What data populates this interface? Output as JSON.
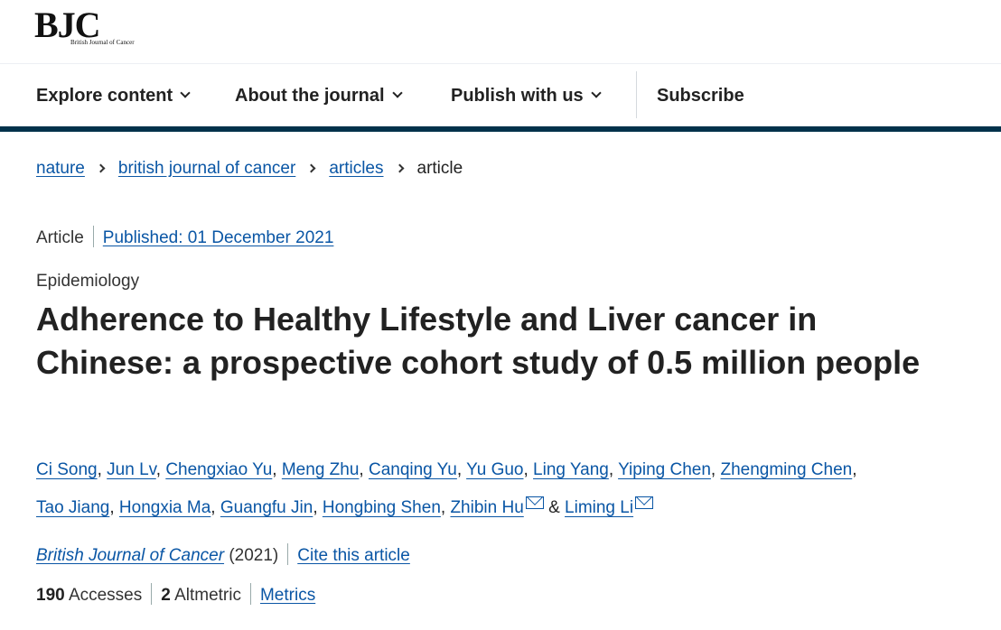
{
  "logo": {
    "text": "BJC",
    "subtitle": "British Journal of Cancer"
  },
  "nav": {
    "explore": "Explore content",
    "about": "About the journal",
    "publish": "Publish with us",
    "subscribe": "Subscribe"
  },
  "breadcrumb": [
    "nature",
    "british journal of cancer",
    "articles",
    "article"
  ],
  "article": {
    "type": "Article",
    "published": "Published: 01 December 2021",
    "subject": "Epidemiology",
    "title": "Adherence to Healthy Lifestyle and Liver cancer in Chinese: a prospective cohort study of 0.5 million people",
    "authors": [
      "Ci Song",
      "Jun Lv",
      "Chengxiao Yu",
      "Meng Zhu",
      "Canqing Yu",
      "Yu Guo",
      "Ling Yang",
      "Yiping Chen",
      "Zhengming Chen",
      "Tao Jiang",
      "Hongxia Ma",
      "Guangfu Jin",
      "Hongbing Shen",
      "Zhibin Hu",
      "Liming Li"
    ],
    "ampersand": "&",
    "journal": "British Journal of Cancer",
    "year": "(2021)",
    "cite": "Cite this article",
    "accesses_count": "190",
    "accesses_label": "Accesses",
    "altmetric_count": "2",
    "altmetric_label": "Altmetric",
    "metrics_link": "Metrics"
  },
  "icons": {
    "nav_chevron": "chevron-down-icon",
    "breadcrumb_sep": "chevron-right-icon",
    "mail": "mail-icon"
  },
  "colors": {
    "link": "#0a56a5",
    "nav_rule": "#01324b",
    "text": "#222222"
  }
}
